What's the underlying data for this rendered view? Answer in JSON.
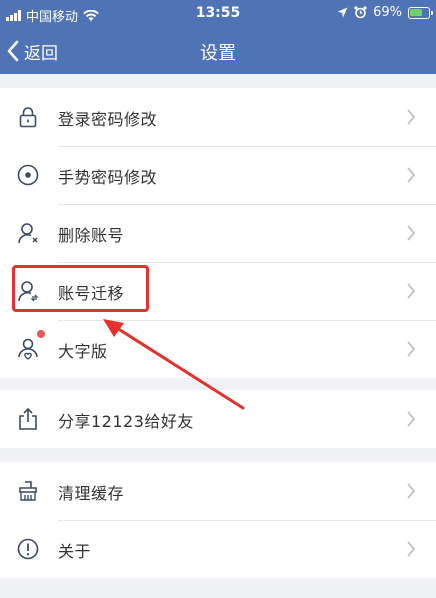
{
  "status_bar": {
    "carrier": "中国移动",
    "time": "13:55",
    "battery": "69%"
  },
  "nav": {
    "back_label": "返回",
    "title": "设置"
  },
  "groups": [
    {
      "items": [
        {
          "label": "登录密码修改",
          "icon": "lock-icon"
        },
        {
          "label": "手势密码修改",
          "icon": "gesture-icon"
        },
        {
          "label": "删除账号",
          "icon": "delete-user-icon"
        },
        {
          "label": "账号迁移",
          "icon": "transfer-user-icon"
        },
        {
          "label": "大字版",
          "icon": "large-font-icon",
          "badge_dot": true
        }
      ]
    },
    {
      "items": [
        {
          "label": "分享12123给好友",
          "icon": "share-icon"
        }
      ]
    },
    {
      "items": [
        {
          "label": "清理缓存",
          "icon": "broom-icon"
        },
        {
          "label": "关于",
          "icon": "info-icon"
        }
      ]
    }
  ],
  "annotation": {
    "highlighted_item": "账号迁移",
    "color": "#e5322d"
  },
  "colors": {
    "header": "#5073b6",
    "background": "#f0f1f4",
    "badge": "#e65a5a"
  }
}
